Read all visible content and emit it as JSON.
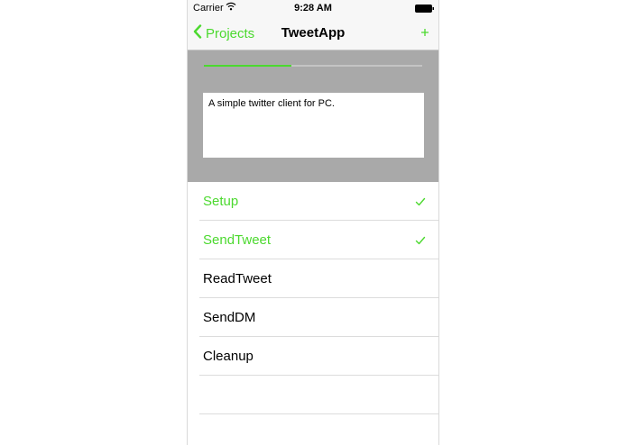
{
  "status_bar": {
    "carrier": "Carrier",
    "time": "9:28 AM",
    "wifi_icon": "wifi-icon",
    "battery_icon": "battery-icon"
  },
  "nav": {
    "back_label": "Projects",
    "back_icon": "chevron-left-icon",
    "title": "TweetApp",
    "add_label": "+"
  },
  "header": {
    "progress": 0.4,
    "description": "A simple twitter client for PC."
  },
  "steps": [
    {
      "label": "Setup",
      "done": true
    },
    {
      "label": "SendTweet",
      "done": true
    },
    {
      "label": "ReadTweet",
      "done": false
    },
    {
      "label": "SendDM",
      "done": false
    },
    {
      "label": "Cleanup",
      "done": false
    }
  ],
  "colors": {
    "accent": "#4cd92f",
    "header_bg": "#a9a9a9",
    "bar_bg": "#f7f7f7"
  }
}
